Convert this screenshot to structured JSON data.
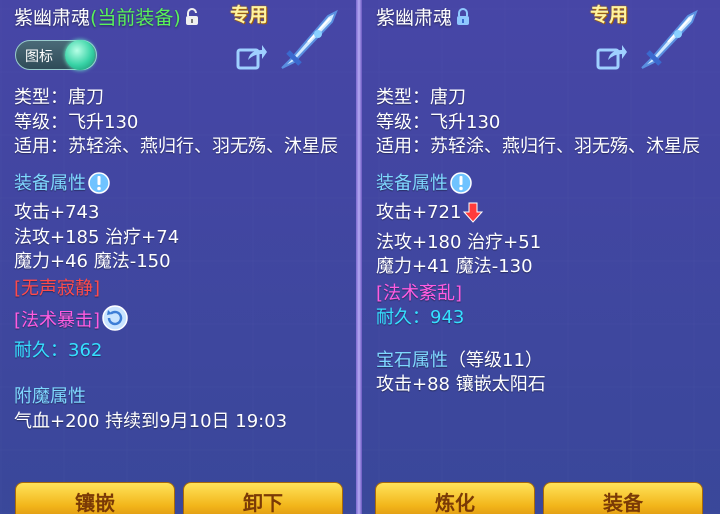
{
  "left": {
    "title": "紫幽肃魂",
    "equip_tag": "(当前装备)",
    "exclusive": "专用",
    "toggle_label": "图标",
    "type_line": "类型：唐刀",
    "level_line": "等级：飞升130",
    "applicable_line": "适用：苏轻涂、燕归行、羽无殇、沐星辰",
    "attr_header": "装备属性",
    "attack": "攻击+743",
    "mag_heal": "法攻+185 治疗+74",
    "magic": "魔力+46 魔法-150",
    "skill1": "[无声寂静]",
    "skill2": "[法术暴击]",
    "durability_label": "耐久：",
    "durability_value": "362",
    "enchant_header": "附魔属性",
    "enchant_line": "气血+200 持续到9月10日 19:03",
    "btn1": "镶嵌",
    "btn2": "卸下"
  },
  "right": {
    "title": "紫幽肃魂",
    "exclusive": "专用",
    "type_line": "类型：唐刀",
    "level_line": "等级：飞升130",
    "applicable_line": "适用：苏轻涂、燕归行、羽无殇、沐星辰",
    "attr_header": "装备属性",
    "attack": "攻击+721",
    "mag_heal": "法攻+180 治疗+51",
    "magic": "魔力+41 魔法-130",
    "skill1": "[法术紊乱]",
    "durability_label": "耐久：",
    "durability_value": "943",
    "gem_header": "宝石属性",
    "gem_level": "（等级11）",
    "gem_line": "攻击+88 镶嵌太阳石",
    "btn1": "炼化",
    "btn2": "装备"
  },
  "icons": {
    "lock_open": "lock-open-icon",
    "lock_closed": "lock-closed-icon",
    "share": "share-icon",
    "info": "info-icon",
    "down_arrow": "down-arrow-icon",
    "refresh": "refresh-icon",
    "weapon": "sword-icon"
  },
  "colors": {
    "equip_tag": "#59f25a",
    "attr_header": "#7fd8ff",
    "skill_red": "#ff4a4a",
    "skill_magenta": "#ff5ce0",
    "durability": "#35e0ff",
    "button": "#f2b51a"
  }
}
